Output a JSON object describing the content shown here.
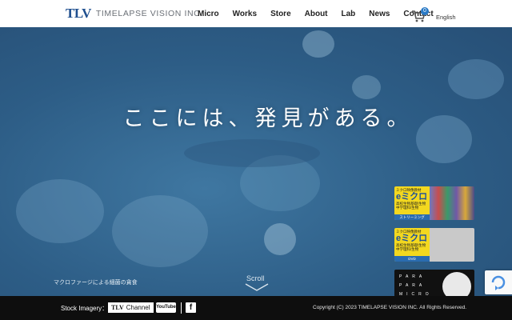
{
  "header": {
    "logo_mark": "TLV",
    "logo_text": "TIMELAPSE VISION INC.",
    "nav": [
      "Micro",
      "Works",
      "Store",
      "About",
      "Lab",
      "News",
      "Contact"
    ],
    "cart_count": "0",
    "language": "English"
  },
  "hero": {
    "headline": "ここには、発見がある。",
    "caption": "マクロファージによる細菌の貪食",
    "scroll_label": "Scroll",
    "cards": [
      {
        "small_line1": "ミクロ映像教材",
        "big": "eミクロ",
        "small_line2": "高校生物基礎/生物",
        "small_line3": "中学理科/生物",
        "strip": "ストリーミング"
      },
      {
        "small_line1": "ミクロ映像教材",
        "big": "eミクロ",
        "small_line2": "高校生物基礎/生物",
        "small_line3": "中学理科/生物",
        "strip": "DVD"
      },
      {
        "para": "PARA PARA MICRO"
      }
    ]
  },
  "footer": {
    "stock_label": "Stock Imagery：",
    "tlv_channel_mark": "TLV",
    "tlv_channel_text": "Channel",
    "youtube_text": "YouTube",
    "facebook_text": "f",
    "copyright": "Copyright (C) 2023 TIMELAPSE VISION INC. All Rights Reserved."
  },
  "colors": {
    "brand": "#1f4f8f",
    "hero_bg": "#2f5f86",
    "footer_bg": "#0e0e0e",
    "badge": "#2a7ac6",
    "card_yellow": "#f3d81f"
  }
}
